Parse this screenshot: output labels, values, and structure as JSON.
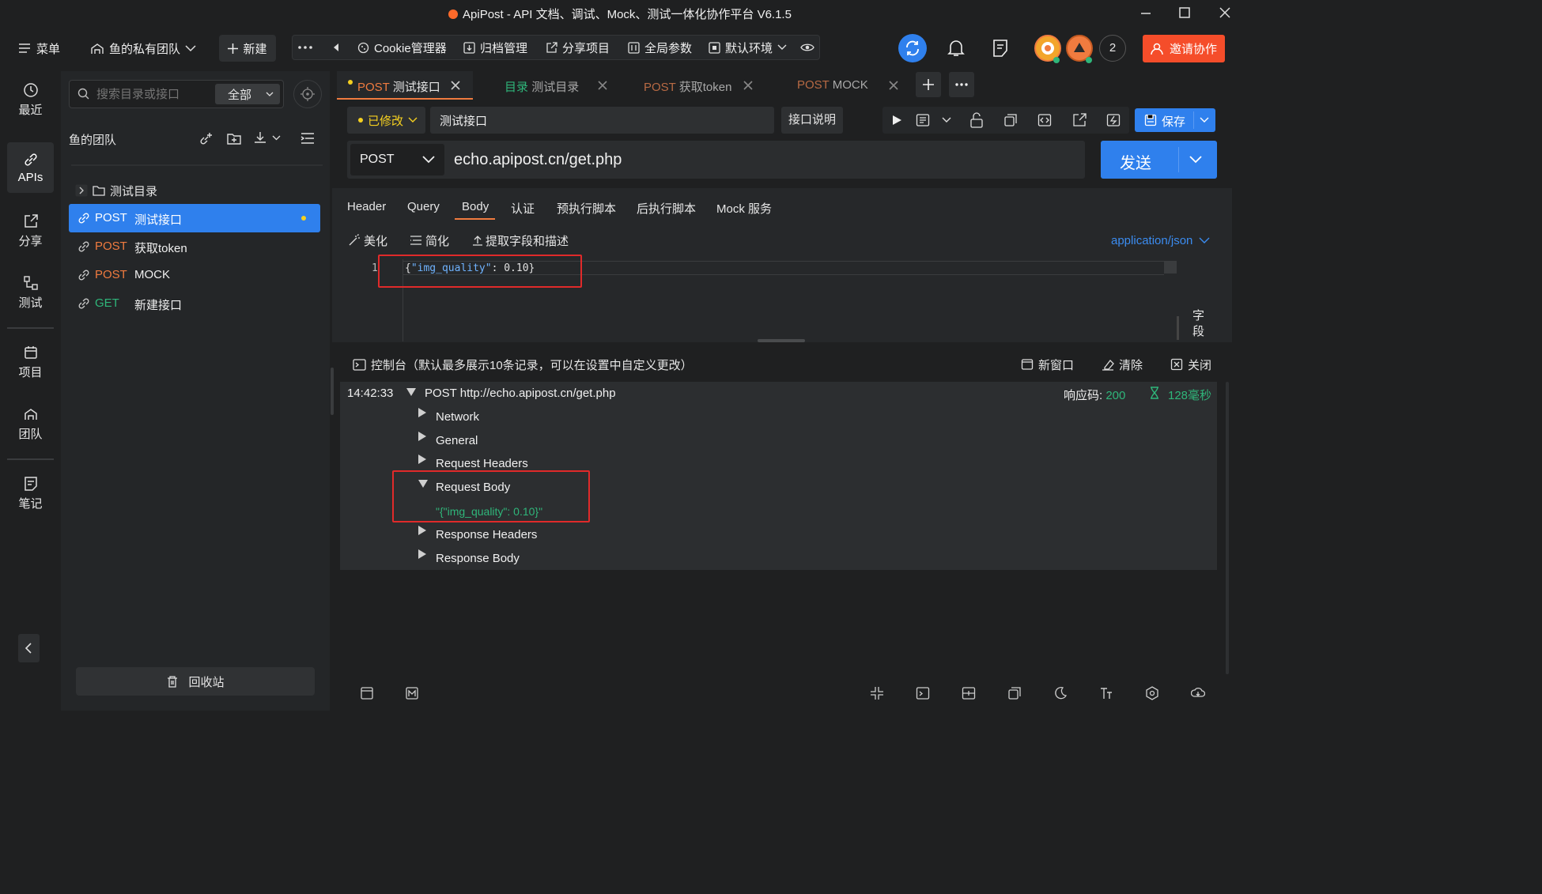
{
  "window": {
    "title": "ApiPost - API 文档、调试、Mock、测试一体化协作平台 V6.1.5"
  },
  "topbar": {
    "menu_label": "菜单",
    "team_label": "鱼的私有团队",
    "new_label": "新建",
    "cookie_label": "Cookie管理器",
    "archive_label": "归档管理",
    "share_label": "分享项目",
    "params_label": "全局参数",
    "env_label": "默认环境",
    "avatar_count": "2",
    "invite_label": "邀请协作"
  },
  "rail": {
    "recent": "最近",
    "apis": "APIs",
    "share": "分享",
    "test": "测试",
    "project": "项目",
    "team": "团队",
    "notes": "笔记"
  },
  "sidebar": {
    "search_placeholder": "搜索目录或接口",
    "filter_label": "全部",
    "team_title": "鱼的团队",
    "folder": "测试目录",
    "items": [
      {
        "method": "POST",
        "name": "测试接口",
        "active": true
      },
      {
        "method": "POST",
        "name": "获取token"
      },
      {
        "method": "POST",
        "name": "MOCK"
      },
      {
        "method": "GET",
        "name": "新建接口"
      }
    ],
    "trash_label": "回收站"
  },
  "tabs": [
    {
      "prefix": "POST",
      "label": "测试接口"
    },
    {
      "prefix": "目录",
      "label": "测试目录"
    },
    {
      "prefix": "POST",
      "label": "获取token"
    },
    {
      "prefix": "POST",
      "label": "MOCK"
    }
  ],
  "request": {
    "status_label": "已修改",
    "name_value": "测试接口",
    "doc_button": "接口说明",
    "save_label": "保存",
    "method": "POST",
    "url": "echo.apipost.cn/get.php",
    "send_label": "发送"
  },
  "subtabs": [
    "Header",
    "Query",
    "Body",
    "认证",
    "预执行脚本",
    "后执行脚本",
    "Mock 服务"
  ],
  "body_tools": {
    "beautify": "美化",
    "simplify": "简化",
    "extract": "提取字段和描述",
    "content_type": "application/json",
    "side_label": "字段"
  },
  "editor": {
    "line_number": "1",
    "key": "\"img_quality\"",
    "value": "0.10"
  },
  "console": {
    "title": "控制台（默认最多展示10条记录，可以在设置中自定义更改）",
    "new_window": "新窗口",
    "clear": "清除",
    "close": "关闭",
    "time": "14:42:33",
    "request_line": "POST http://echo.apipost.cn/get.php",
    "status_label": "响应码:",
    "status_code": "200",
    "duration": "128毫秒",
    "sections": [
      "Network",
      "General",
      "Request Headers",
      "Request Body",
      "Response Headers",
      "Response Body"
    ],
    "request_body_value": "\"{\"img_quality\": 0.10}\""
  },
  "colors": {
    "accent": "#2f80ed",
    "post": "#f07b3f",
    "get": "#2fb67a",
    "success": "#2fb67a",
    "invite": "#f54d2a",
    "highlight": "#e02a2a"
  }
}
